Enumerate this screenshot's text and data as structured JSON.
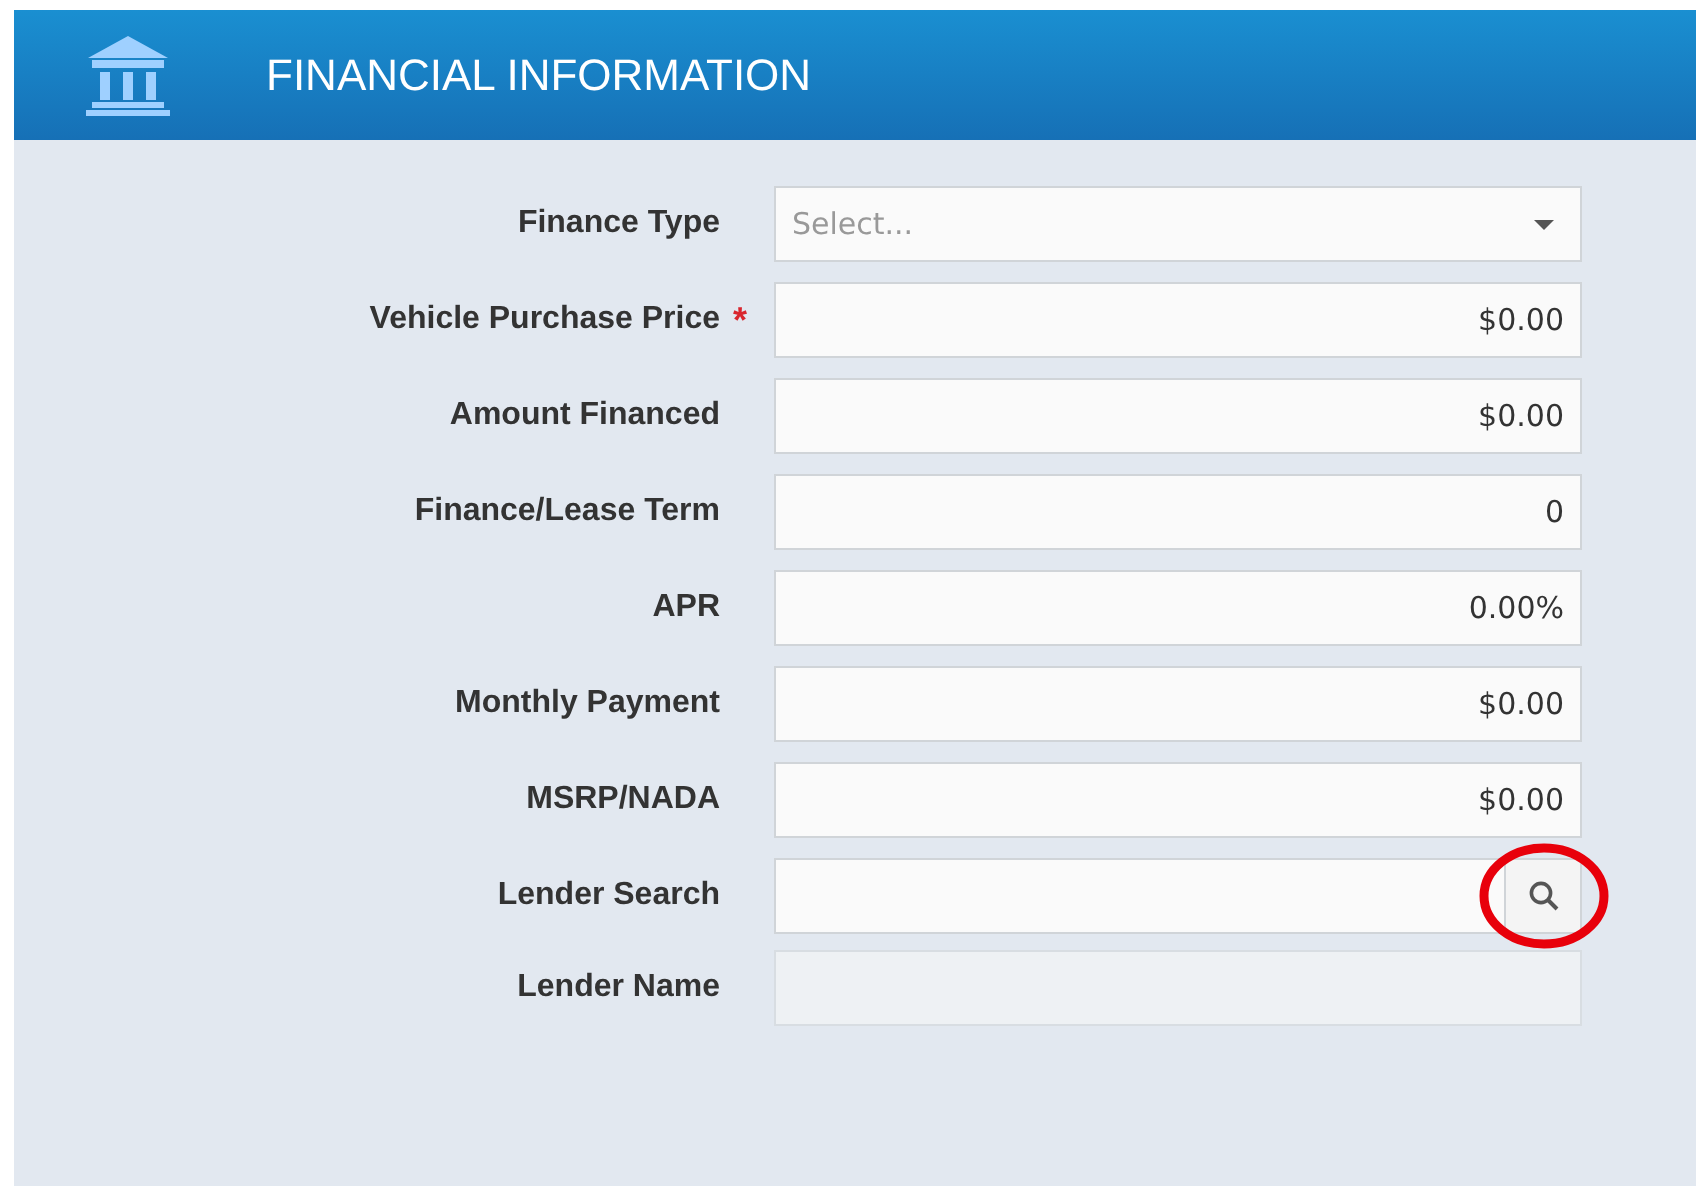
{
  "header": {
    "title": "FINANCIAL INFORMATION"
  },
  "fields": [
    {
      "kind": "select",
      "label": "Finance Type",
      "placeholder": "Select..."
    },
    {
      "kind": "input",
      "label": "Vehicle Purchase Price",
      "required_mark": "*",
      "value": "$0.00"
    },
    {
      "kind": "input",
      "label": "Amount Financed",
      "value": "$0.00"
    },
    {
      "kind": "input",
      "label": "Finance/Lease Term",
      "value": "0"
    },
    {
      "kind": "input",
      "label": "APR",
      "value": "0.00%"
    },
    {
      "kind": "input",
      "label": "Monthly Payment",
      "value": "$0.00"
    },
    {
      "kind": "input",
      "label": "MSRP/NADA",
      "value": "$0.00"
    },
    {
      "kind": "search",
      "label": "Lender Search",
      "highlighted": true
    },
    {
      "kind": "readonly",
      "label": "Lender Name"
    }
  ]
}
